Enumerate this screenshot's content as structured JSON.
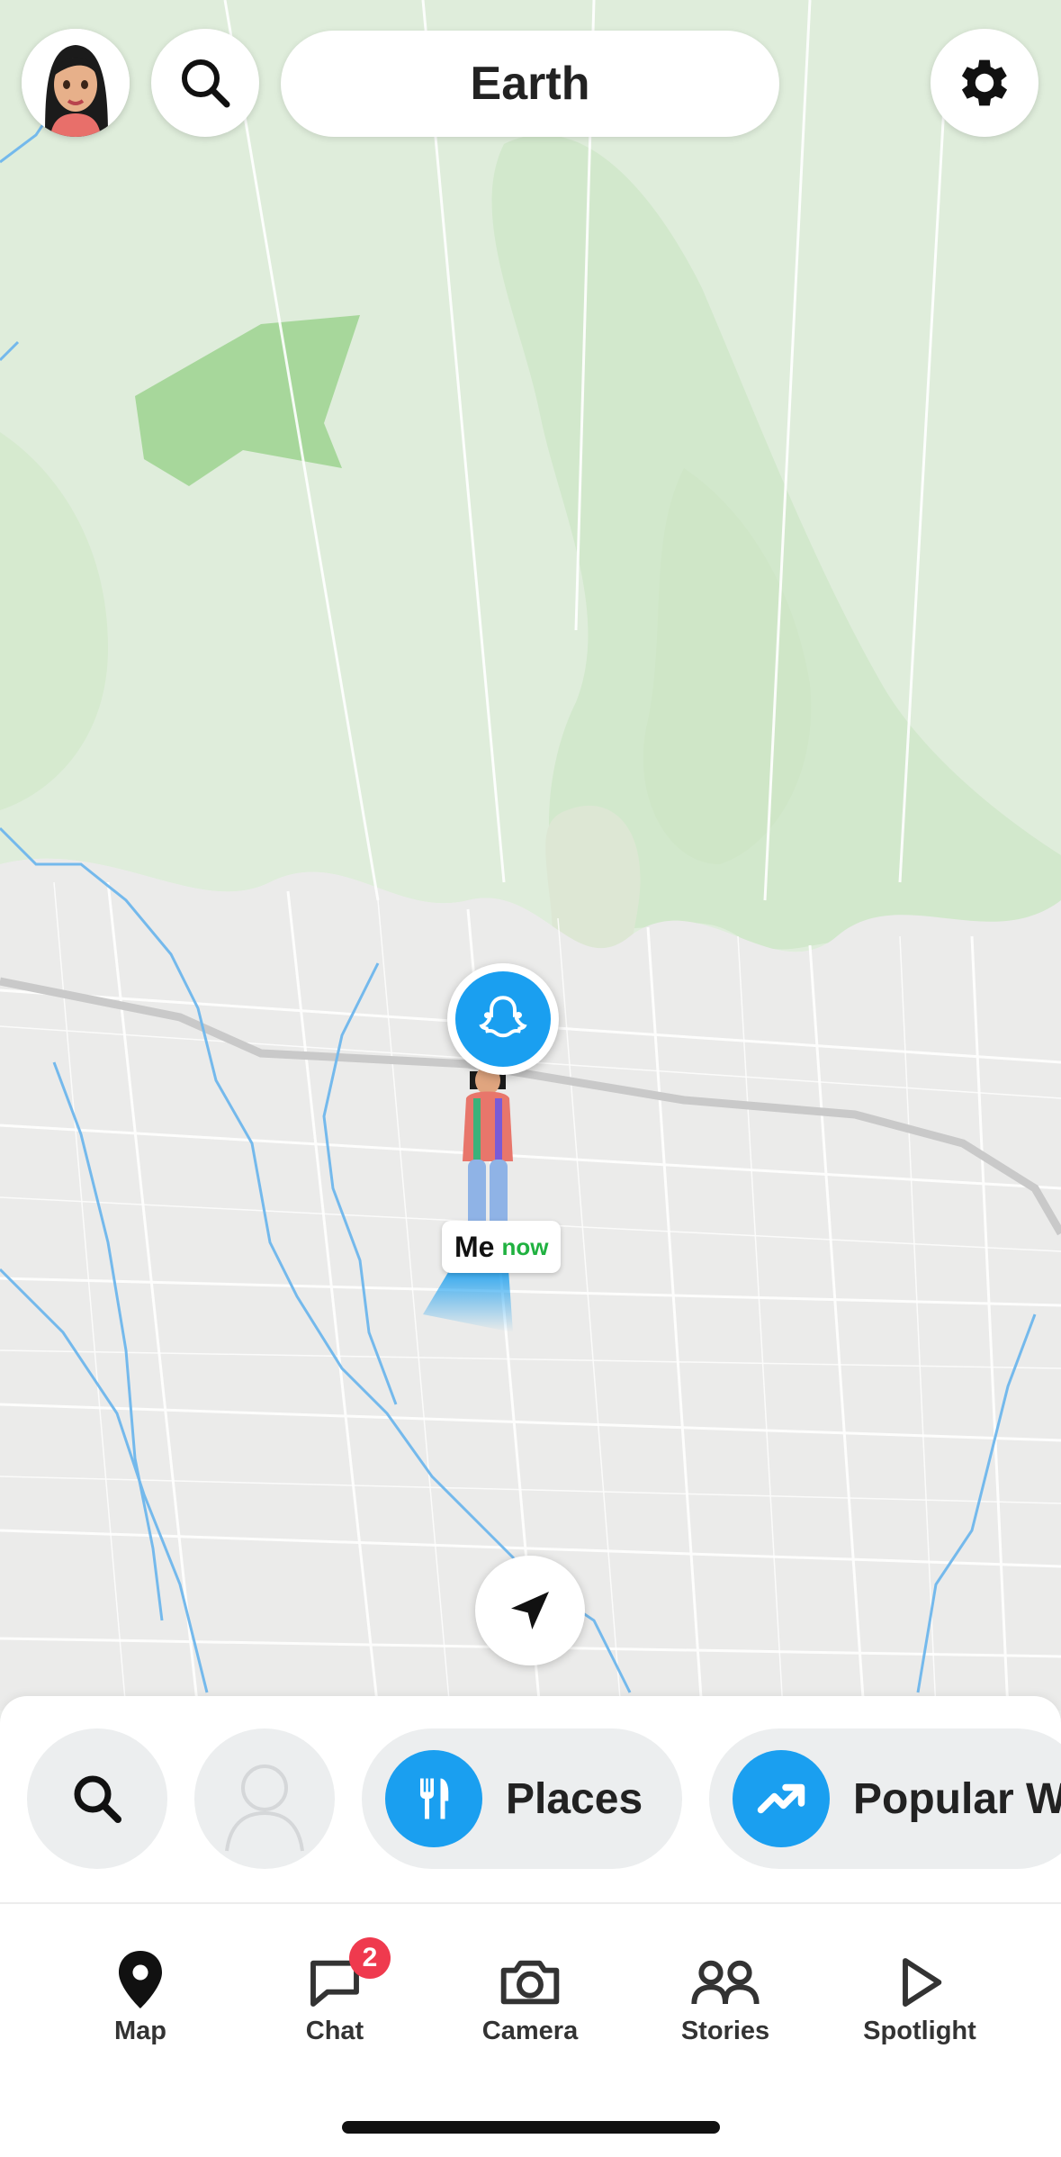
{
  "header": {
    "title": "Earth",
    "avatar_icon": "bitmoji-avatar",
    "search_icon": "search-icon",
    "settings_icon": "gear-icon"
  },
  "map": {
    "user_label": "Me",
    "user_status": "now",
    "user_marker_icon": "snapchat-ghost-icon",
    "locate_icon": "navigation-arrow-icon"
  },
  "chips": {
    "search_icon": "search-icon",
    "friend_placeholder_icon": "person-silhouette-icon",
    "places_label": "Places",
    "places_icon": "fork-knife-icon",
    "popular_label": "Popular W",
    "popular_icon": "trending-arrow-icon"
  },
  "nav": {
    "items": [
      {
        "label": "Map",
        "icon": "map-pin-icon"
      },
      {
        "label": "Chat",
        "icon": "chat-bubble-icon",
        "badge": "2"
      },
      {
        "label": "Camera",
        "icon": "camera-icon"
      },
      {
        "label": "Stories",
        "icon": "people-icon"
      },
      {
        "label": "Spotlight",
        "icon": "play-icon"
      }
    ]
  },
  "colors": {
    "accent": "#1a9ff0",
    "badge": "#ef3a4e",
    "status_green": "#20b140",
    "park_green": "#a7d79b"
  }
}
